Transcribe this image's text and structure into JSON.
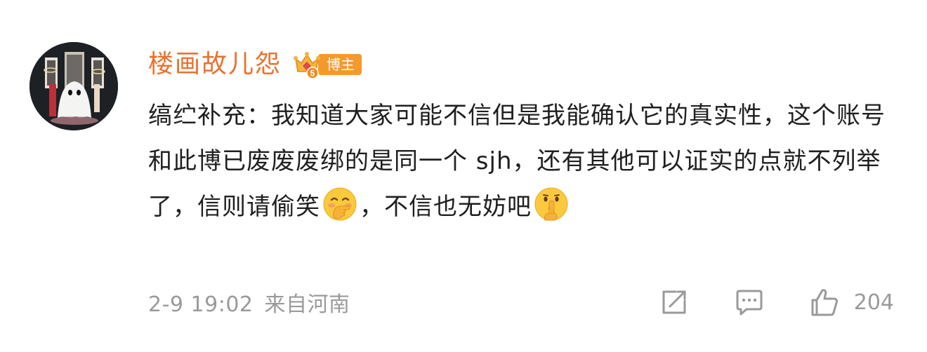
{
  "comment": {
    "author": {
      "name": "楼画故儿怨",
      "badge_level": "5",
      "badge_label": "博主"
    },
    "content": {
      "segments": [
        "缟纻补充：我知道大家可能不信但是我能确认它的真实性，这个账号和此博已废废废绑的是同一个 sjh，还有其他可以证实的点就不列举了，信则请偷笑",
        "，不信也无妨吧"
      ],
      "emojis": [
        "hand-over-mouth-emoji",
        "shushing-face-emoji"
      ]
    },
    "meta": {
      "time": "2-9 19:02",
      "location": "来自河南"
    },
    "actions": {
      "like_count": "204"
    },
    "colors": {
      "username": "#e8722e",
      "badge": "#f49a2a",
      "meta": "#9a9a9a",
      "text": "#1f1f1f"
    }
  }
}
